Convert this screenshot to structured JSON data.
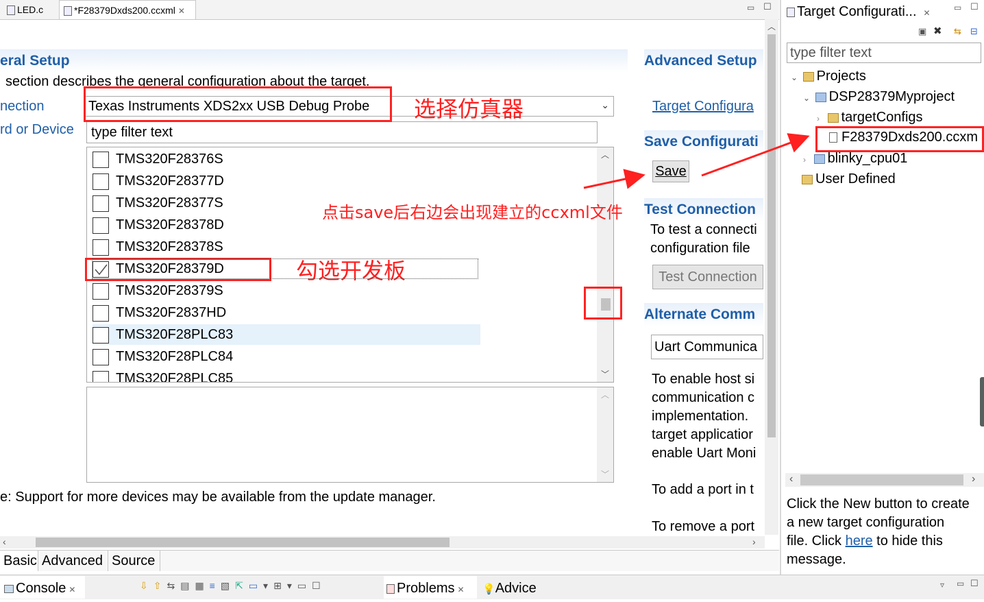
{
  "editor": {
    "tabs": [
      {
        "label": "LED.c"
      },
      {
        "label": "*F28379Dxds200.ccxml"
      }
    ]
  },
  "general": {
    "header": "eral Setup",
    "desc": "section describes the general configuration about the target.",
    "connection_label": "nection",
    "connection_value": "Texas Instruments XDS2xx USB Debug Probe",
    "board_label": "rd or Device",
    "filter_text": "type filter text",
    "devices": [
      {
        "name": "TMS320F28376S",
        "checked": false
      },
      {
        "name": "TMS320F28377D",
        "checked": false
      },
      {
        "name": "TMS320F28377S",
        "checked": false
      },
      {
        "name": "TMS320F28378D",
        "checked": false
      },
      {
        "name": "TMS320F28378S",
        "checked": false
      },
      {
        "name": "TMS320F28379D",
        "checked": true
      },
      {
        "name": "TMS320F28379S",
        "checked": false
      },
      {
        "name": "TMS320F2837HD",
        "checked": false
      },
      {
        "name": "TMS320F28PLC83",
        "checked": false
      },
      {
        "name": "TMS320F28PLC84",
        "checked": false
      },
      {
        "name": "TMS320F28PLC85",
        "checked": false
      }
    ],
    "note": "e: Support for more devices may be available from the update manager."
  },
  "advanced": {
    "header": "Advanced Setup",
    "target_link": "Target Configura",
    "save_header": "Save Configurati",
    "save_button": "Save",
    "test_header": "Test Connection",
    "test_desc_1": "To test a connecti",
    "test_desc_2": "configuration file",
    "test_button": "Test Connection",
    "alt_header": "Alternate Comm",
    "uart_value": "Uart Communica",
    "uart_desc": [
      "To enable host si",
      "communication c",
      "implementation.",
      "target applicatior",
      "enable Uart Moni"
    ],
    "add_port": "To add a port in t",
    "remove_port": "To remove a port"
  },
  "bottom_tabs": [
    "Basic",
    "Advanced",
    "Source"
  ],
  "annotations": {
    "select_emulator": "选择仿真器",
    "click_save": "点击save后右边会出现建立的ccxml文件",
    "check_board": "勾选开发板"
  },
  "target_view": {
    "title": "Target Configurati...",
    "filter_text": "type filter text",
    "tree": {
      "projects": "Projects",
      "project": "DSP28379Myproject",
      "target_configs": "targetConfigs",
      "ccxml_file": "F28379Dxds200.ccxm",
      "blinky": "blinky_cpu01",
      "user_defined": "User Defined"
    },
    "info_line1": "Click the New button to create",
    "info_line2": "a new target configuration",
    "info_line3_a": "file. Click ",
    "info_here": "here",
    "info_line3_b": " to hide this",
    "info_line4": "message."
  },
  "bottom_panel": {
    "console_tab": "Console",
    "problems_tab": "Problems",
    "advice_tab": "Advice"
  },
  "colors": {
    "accent": "#1f5fa8",
    "annotation": "#ff2020"
  }
}
